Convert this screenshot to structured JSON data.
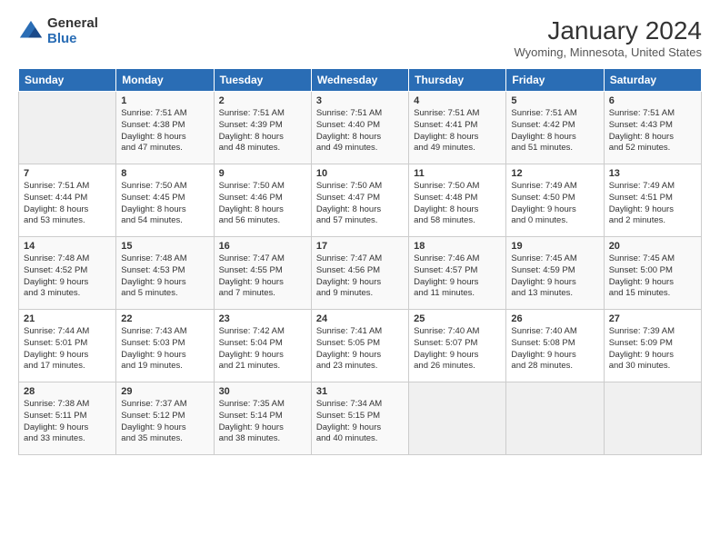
{
  "logo": {
    "general": "General",
    "blue": "Blue"
  },
  "title": "January 2024",
  "location": "Wyoming, Minnesota, United States",
  "headers": [
    "Sunday",
    "Monday",
    "Tuesday",
    "Wednesday",
    "Thursday",
    "Friday",
    "Saturday"
  ],
  "weeks": [
    [
      {
        "day": "",
        "info": ""
      },
      {
        "day": "1",
        "info": "Sunrise: 7:51 AM\nSunset: 4:38 PM\nDaylight: 8 hours\nand 47 minutes."
      },
      {
        "day": "2",
        "info": "Sunrise: 7:51 AM\nSunset: 4:39 PM\nDaylight: 8 hours\nand 48 minutes."
      },
      {
        "day": "3",
        "info": "Sunrise: 7:51 AM\nSunset: 4:40 PM\nDaylight: 8 hours\nand 49 minutes."
      },
      {
        "day": "4",
        "info": "Sunrise: 7:51 AM\nSunset: 4:41 PM\nDaylight: 8 hours\nand 49 minutes."
      },
      {
        "day": "5",
        "info": "Sunrise: 7:51 AM\nSunset: 4:42 PM\nDaylight: 8 hours\nand 51 minutes."
      },
      {
        "day": "6",
        "info": "Sunrise: 7:51 AM\nSunset: 4:43 PM\nDaylight: 8 hours\nand 52 minutes."
      }
    ],
    [
      {
        "day": "7",
        "info": "Sunrise: 7:51 AM\nSunset: 4:44 PM\nDaylight: 8 hours\nand 53 minutes."
      },
      {
        "day": "8",
        "info": "Sunrise: 7:50 AM\nSunset: 4:45 PM\nDaylight: 8 hours\nand 54 minutes."
      },
      {
        "day": "9",
        "info": "Sunrise: 7:50 AM\nSunset: 4:46 PM\nDaylight: 8 hours\nand 56 minutes."
      },
      {
        "day": "10",
        "info": "Sunrise: 7:50 AM\nSunset: 4:47 PM\nDaylight: 8 hours\nand 57 minutes."
      },
      {
        "day": "11",
        "info": "Sunrise: 7:50 AM\nSunset: 4:48 PM\nDaylight: 8 hours\nand 58 minutes."
      },
      {
        "day": "12",
        "info": "Sunrise: 7:49 AM\nSunset: 4:50 PM\nDaylight: 9 hours\nand 0 minutes."
      },
      {
        "day": "13",
        "info": "Sunrise: 7:49 AM\nSunset: 4:51 PM\nDaylight: 9 hours\nand 2 minutes."
      }
    ],
    [
      {
        "day": "14",
        "info": "Sunrise: 7:48 AM\nSunset: 4:52 PM\nDaylight: 9 hours\nand 3 minutes."
      },
      {
        "day": "15",
        "info": "Sunrise: 7:48 AM\nSunset: 4:53 PM\nDaylight: 9 hours\nand 5 minutes."
      },
      {
        "day": "16",
        "info": "Sunrise: 7:47 AM\nSunset: 4:55 PM\nDaylight: 9 hours\nand 7 minutes."
      },
      {
        "day": "17",
        "info": "Sunrise: 7:47 AM\nSunset: 4:56 PM\nDaylight: 9 hours\nand 9 minutes."
      },
      {
        "day": "18",
        "info": "Sunrise: 7:46 AM\nSunset: 4:57 PM\nDaylight: 9 hours\nand 11 minutes."
      },
      {
        "day": "19",
        "info": "Sunrise: 7:45 AM\nSunset: 4:59 PM\nDaylight: 9 hours\nand 13 minutes."
      },
      {
        "day": "20",
        "info": "Sunrise: 7:45 AM\nSunset: 5:00 PM\nDaylight: 9 hours\nand 15 minutes."
      }
    ],
    [
      {
        "day": "21",
        "info": "Sunrise: 7:44 AM\nSunset: 5:01 PM\nDaylight: 9 hours\nand 17 minutes."
      },
      {
        "day": "22",
        "info": "Sunrise: 7:43 AM\nSunset: 5:03 PM\nDaylight: 9 hours\nand 19 minutes."
      },
      {
        "day": "23",
        "info": "Sunrise: 7:42 AM\nSunset: 5:04 PM\nDaylight: 9 hours\nand 21 minutes."
      },
      {
        "day": "24",
        "info": "Sunrise: 7:41 AM\nSunset: 5:05 PM\nDaylight: 9 hours\nand 23 minutes."
      },
      {
        "day": "25",
        "info": "Sunrise: 7:40 AM\nSunset: 5:07 PM\nDaylight: 9 hours\nand 26 minutes."
      },
      {
        "day": "26",
        "info": "Sunrise: 7:40 AM\nSunset: 5:08 PM\nDaylight: 9 hours\nand 28 minutes."
      },
      {
        "day": "27",
        "info": "Sunrise: 7:39 AM\nSunset: 5:09 PM\nDaylight: 9 hours\nand 30 minutes."
      }
    ],
    [
      {
        "day": "28",
        "info": "Sunrise: 7:38 AM\nSunset: 5:11 PM\nDaylight: 9 hours\nand 33 minutes."
      },
      {
        "day": "29",
        "info": "Sunrise: 7:37 AM\nSunset: 5:12 PM\nDaylight: 9 hours\nand 35 minutes."
      },
      {
        "day": "30",
        "info": "Sunrise: 7:35 AM\nSunset: 5:14 PM\nDaylight: 9 hours\nand 38 minutes."
      },
      {
        "day": "31",
        "info": "Sunrise: 7:34 AM\nSunset: 5:15 PM\nDaylight: 9 hours\nand 40 minutes."
      },
      {
        "day": "",
        "info": ""
      },
      {
        "day": "",
        "info": ""
      },
      {
        "day": "",
        "info": ""
      }
    ]
  ]
}
